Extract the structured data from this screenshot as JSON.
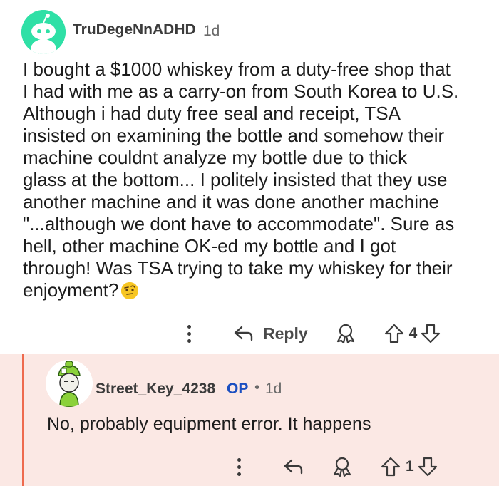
{
  "comments": [
    {
      "username": "TruDegeNnADHD",
      "age": "1d",
      "body_lines": [
        "I bought a $1000 whiskey from a duty-free shop that",
        "I had with me as a carry-on from South Korea to U.S.",
        "Although i had duty free seal and receipt, TSA",
        "insisted on examining the bottle and somehow their",
        "machine couldnt analyze my bottle due to thick",
        "glass at the bottom... I politely insisted that they use",
        "another machine and it was done another machine",
        "\"...although we dont have to accommodate\". Sure as",
        "hell, other machine OK-ed my bottle and I got",
        "through! Was TSA trying to take my whiskey for their",
        "enjoyment?"
      ],
      "emoji": "face-with-raised-eyebrow",
      "reply_label": "Reply",
      "vote_count": "4",
      "avatar_color": "#2fe0a6"
    },
    {
      "username": "Street_Key_4238",
      "op_badge": "OP",
      "separator": "•",
      "age": "1d",
      "body": "No, probably equipment error. It happens",
      "vote_count": "1",
      "thread_color": "#ee6a4e",
      "background": "#fbe8e4"
    }
  ],
  "icons": [
    "more-icon",
    "reply-icon",
    "award-icon",
    "upvote-icon",
    "downvote-icon"
  ]
}
